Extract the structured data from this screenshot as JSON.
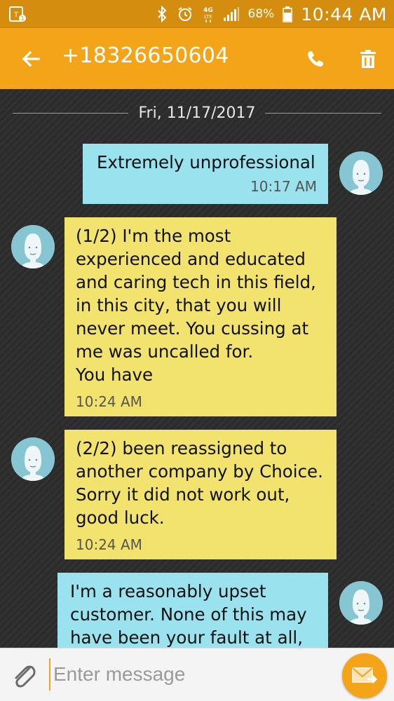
{
  "status_bar": {
    "battery_percent": "68%",
    "time": "10:44 AM",
    "network": "4G LTE",
    "icons": [
      "sim-icon",
      "bluetooth-icon",
      "alarm-icon",
      "lte-icon",
      "signal-icon",
      "battery-icon"
    ]
  },
  "header": {
    "title": "+18326650604",
    "back_icon": "arrow-left-icon",
    "call_icon": "phone-icon",
    "delete_icon": "trash-icon",
    "bar_color": "#f4a419"
  },
  "conversation": {
    "date": "Fri, 11/17/2017",
    "messages": [
      {
        "direction": "sent",
        "text": "Extremely unprofessional",
        "time": "10:17 AM"
      },
      {
        "direction": "received",
        "text": "(1/2) I'm the most\nexperienced and educated\nand caring tech in this field,\nin this city, that you will\nnever meet. You cussing at\nme was uncalled for.\nYou have",
        "time": "10:24 AM"
      },
      {
        "direction": "received",
        "text": "(2/2)  been reassigned to\nanother company by Choice.\nSorry it did not work out,\ngood luck.",
        "time": "10:24 AM"
      },
      {
        "direction": "sent",
        "text": "I'm a reasonably upset\ncustomer. None of this may\nhave been your fault at all,",
        "time": ""
      }
    ],
    "colors": {
      "sent": "#9be2ef",
      "received": "#f2e36f"
    }
  },
  "composer": {
    "placeholder": "Enter message",
    "value": "",
    "attach_icon": "paperclip-icon",
    "send_icon": "send-envelope-icon"
  }
}
